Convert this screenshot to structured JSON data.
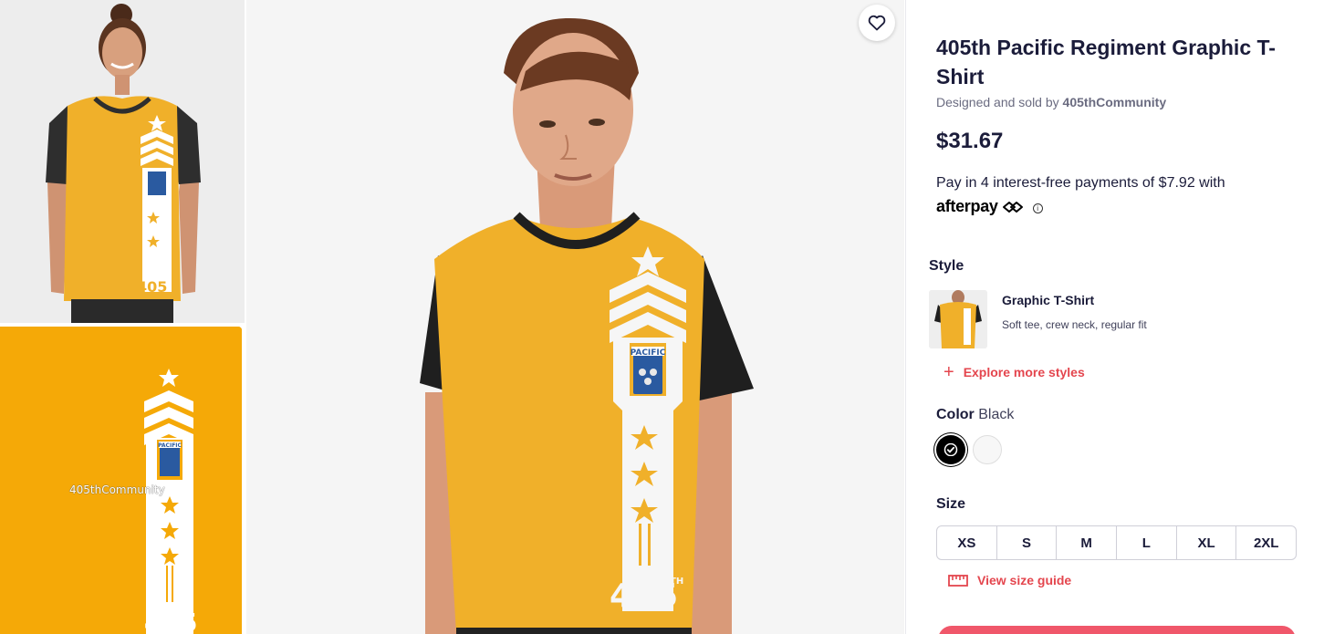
{
  "product": {
    "title": "405th Pacific Regiment Graphic T-Shirt",
    "byline_prefix": "Designed and sold by",
    "artist": "405thCommunity",
    "price": "$31.67",
    "installments": "Pay in 4 interest-free payments of $7.92 with",
    "afterpay_logo": "afterpay",
    "info_icon": "ⓘ"
  },
  "thumbnails": {
    "watermark": "405thCommunity",
    "print_badge": "PACIFIC",
    "print_number": "405"
  },
  "main_image": {
    "badge_text": "PACIFIC",
    "number_text": "405",
    "number_sup": "TH"
  },
  "favorite": {
    "icon": "heart-icon"
  },
  "style": {
    "label": "Style",
    "name": "Graphic T-Shirt",
    "description": "Soft tee, crew neck, regular fit",
    "explore_icon": "+",
    "explore_label": "Explore more styles"
  },
  "color": {
    "label": "Color",
    "selected": "Black",
    "swatches": [
      {
        "name": "Black",
        "hex": "#000000",
        "selected": true
      },
      {
        "name": "White",
        "hex": "#f7f7f7",
        "selected": false
      }
    ]
  },
  "size": {
    "label": "Size",
    "options": [
      "XS",
      "S",
      "M",
      "L",
      "XL",
      "2XL"
    ],
    "guide_label": "View size guide"
  },
  "colors": {
    "accent": "#e4464e",
    "shirt_yellow": "#f0b02a",
    "text_dark": "#1b1c3a"
  }
}
